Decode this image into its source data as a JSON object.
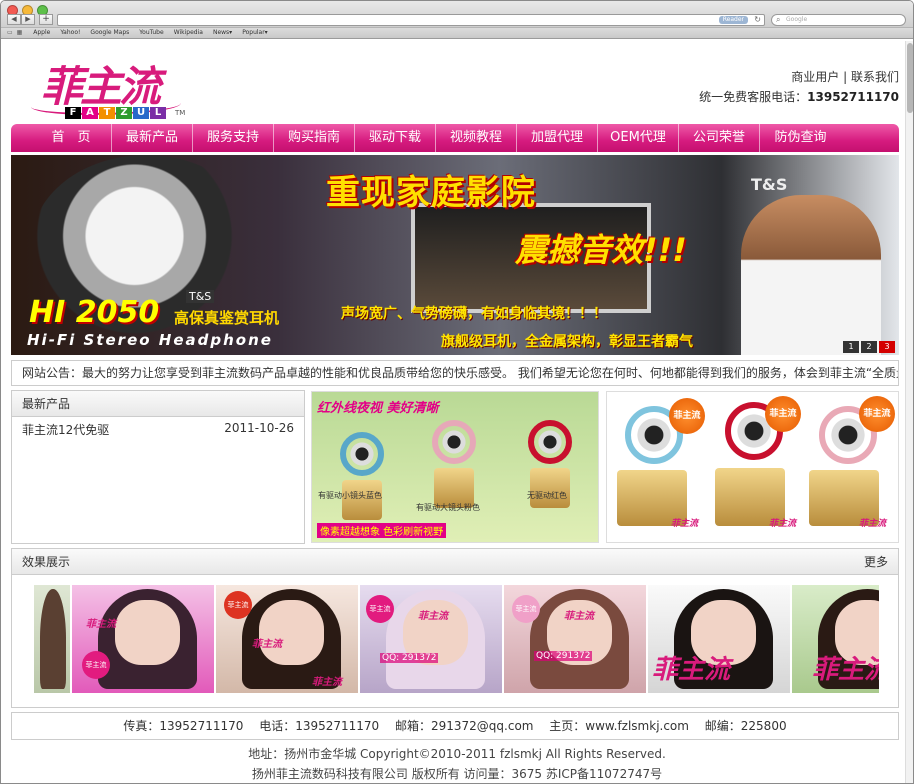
{
  "browser": {
    "reader_label": "Reader",
    "search_placeholder": "Google",
    "bookmarks": [
      "Apple",
      "Yahoo!",
      "Google Maps",
      "YouTube",
      "Wikipedia",
      "News▾",
      "Popular▾"
    ]
  },
  "header": {
    "logo_text": "菲主流",
    "logo_sub": [
      "F",
      "A",
      "T",
      "Z",
      "U",
      "L"
    ],
    "logo_tm": "TM",
    "link_business": "商业用户",
    "separator": "|",
    "link_contact": "联系我们",
    "hotline_label": "统一免费客服电话：",
    "hotline_number": "13952711170"
  },
  "nav": {
    "items": [
      "首　页",
      "最新产品",
      "服务支持",
      "购买指南",
      "驱动下载",
      "视频教程",
      "加盟代理",
      "OEM代理",
      "公司荣誉",
      "防伪查询"
    ]
  },
  "banner": {
    "title1": "重现家庭影院",
    "title2": "震撼音效!!!",
    "model": "HI 2050",
    "model_sub": "高保真鉴赏耳机",
    "hifi": "Hi-Fi Stereo Headphone",
    "slogan1": "声场宽广、气势磅礴，有如身临其境！！！",
    "slogan2": "旗舰级耳机，全金属架构，彰显王者霸气",
    "brand": "T&S",
    "pager": [
      "1",
      "2",
      "3"
    ]
  },
  "notice": {
    "text": "网站公告：最大的努力让您享受到菲主流数码产品卓越的性能和优良品质带给您的快乐感受。 我们希望无论您在何时、何地都能得到我们的服务，体会到菲主流“全质量服"
  },
  "latest": {
    "title": "最新产品",
    "items": [
      {
        "name": "菲主流12代免驱",
        "date": "2011-10-26"
      }
    ]
  },
  "promo1": {
    "title": "红外线夜视 美好清晰",
    "label1": "有驱动小镜头蓝色",
    "label2": "有驱动大镜头粉色",
    "label3": "无驱动红色",
    "bottom": "像素超越想象 色彩刷新视野"
  },
  "promo2": {
    "badge": "菲主流"
  },
  "showcase": {
    "title": "效果展示",
    "more": "更多",
    "mark": "菲主流",
    "qq": "QQ: 291372"
  },
  "footer": {
    "contact": "传真：13952711170　 电话：13952711170　 邮箱：291372@qq.com　 主页：www.fzlsmkj.com　 邮编：225800",
    "address": "地址：扬州市金华城 Copyright©2010-2011 fzlsmkj All Rights Reserved.",
    "company": "扬州菲主流数码科技有限公司 版权所有  访问量：3675  苏ICP备11072747号"
  },
  "colors": {
    "brand_pink": "#d81b7c",
    "nav_gradient_top": "#ef5aa8",
    "accent_orange": "#e55a00"
  }
}
